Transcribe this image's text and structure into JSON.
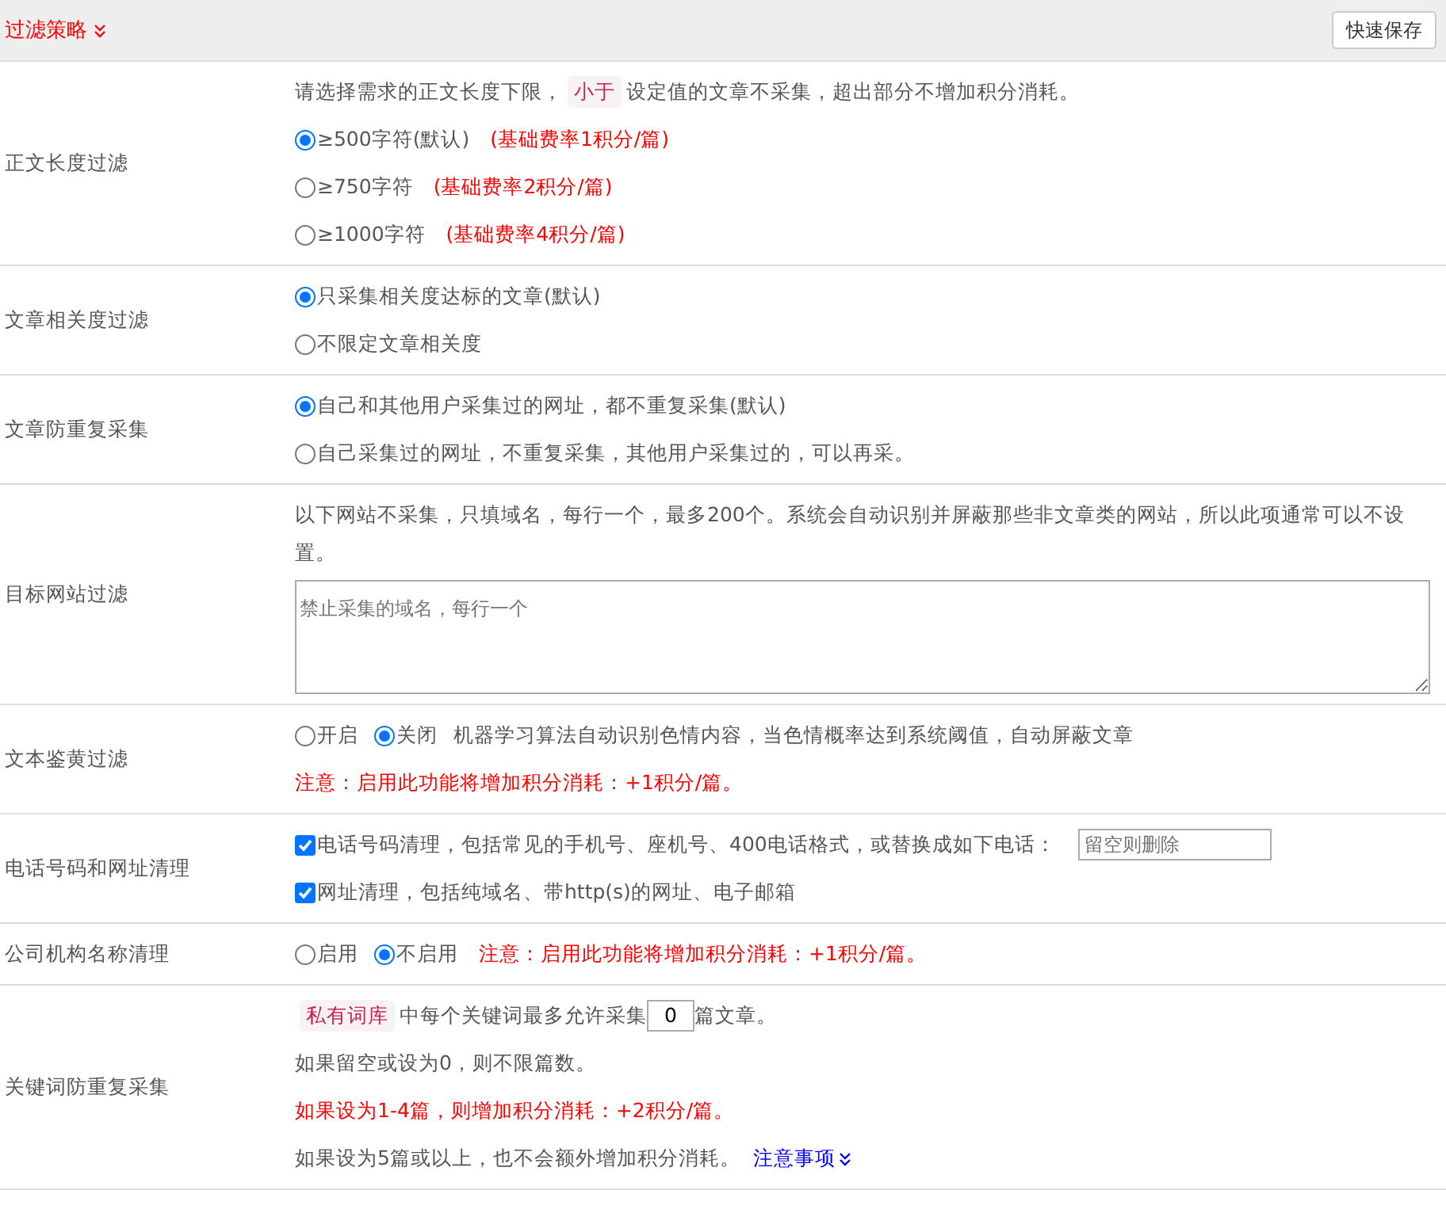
{
  "header": {
    "title": "过滤策略",
    "save_button": "快速保存"
  },
  "rows": [
    {
      "label": "正文长度过滤",
      "lines": [
        [
          {
            "kind": "text",
            "text": "请选择需求的正文长度下限，"
          },
          {
            "kind": "tag",
            "text": "小于"
          },
          {
            "kind": "text",
            "text": "设定值的文章不采集，超出部分不增加积分消耗。"
          }
        ],
        [
          {
            "kind": "radio",
            "text": "≥500字符(默认)",
            "selected": true
          },
          {
            "kind": "note",
            "text": "(基础费率1积分/篇)"
          }
        ],
        [
          {
            "kind": "radio",
            "text": "≥750字符",
            "selected": false
          },
          {
            "kind": "note",
            "text": "(基础费率2积分/篇)"
          }
        ],
        [
          {
            "kind": "radio",
            "text": "≥1000字符",
            "selected": false
          },
          {
            "kind": "note",
            "text": "(基础费率4积分/篇)"
          }
        ]
      ]
    },
    {
      "label": "文章相关度过滤",
      "lines": [
        [
          {
            "kind": "radio",
            "text": "只采集相关度达标的文章(默认)",
            "selected": true
          }
        ],
        [
          {
            "kind": "radio",
            "text": "不限定文章相关度",
            "selected": false
          }
        ]
      ]
    },
    {
      "label": "文章防重复采集",
      "lines": [
        [
          {
            "kind": "radio",
            "text": "自己和其他用户采集过的网址，都不重复采集(默认)",
            "selected": true
          }
        ],
        [
          {
            "kind": "radio",
            "text": "自己采集过的网址，不重复采集，其他用户采集过的，可以再采。",
            "selected": false
          }
        ]
      ]
    },
    {
      "label": "目标网站过滤",
      "lines": [
        [
          {
            "kind": "text",
            "text": "以下网站不采集，只填域名，每行一个，最多200个。系统会自动识别并屏蔽那些非文章类的网站，所以此项通常可以不设置。"
          }
        ],
        [
          {
            "kind": "textarea",
            "placeholder": "禁止采集的域名，每行一个"
          }
        ]
      ]
    },
    {
      "label": "文本鉴黄过滤",
      "lines": [
        [
          {
            "kind": "radio",
            "text": "开启",
            "selected": false
          },
          {
            "kind": "radio",
            "text": "关闭",
            "selected": true
          },
          {
            "kind": "text",
            "text": "机器学习算法自动识别色情内容，当色情概率达到系统阈值，自动屏蔽文章"
          }
        ],
        [
          {
            "kind": "note",
            "text": "注意：启用此功能将增加积分消耗：+1积分/篇。"
          }
        ]
      ]
    },
    {
      "label": "电话号码和网址清理",
      "lines": [
        [
          {
            "kind": "checkbox",
            "text": "电话号码清理，包括常见的手机号、座机号、400电话格式，或替换成如下电话：",
            "checked": true
          },
          {
            "kind": "input",
            "placeholder": "留空则删除"
          }
        ],
        [
          {
            "kind": "checkbox",
            "text": "网址清理，包括纯域名、带http(s)的网址、电子邮箱",
            "checked": true
          }
        ]
      ]
    },
    {
      "label": "公司机构名称清理",
      "lines": [
        [
          {
            "kind": "radio",
            "text": "启用",
            "selected": false
          },
          {
            "kind": "radio",
            "text": "不启用",
            "selected": true
          },
          {
            "kind": "note",
            "text": "注意：启用此功能将增加积分消耗：+1积分/篇。"
          }
        ]
      ]
    },
    {
      "label": "关键词防重复采集",
      "lines": [
        [
          {
            "kind": "tag",
            "text": "私有词库"
          },
          {
            "kind": "text",
            "text": "中每个关键词最多允许采集"
          },
          {
            "kind": "number",
            "value": "0"
          },
          {
            "kind": "text",
            "text": "篇文章。"
          }
        ],
        [
          {
            "kind": "text",
            "text": "如果留空或设为0，则不限篇数。"
          }
        ],
        [
          {
            "kind": "note",
            "text": "如果设为1-4篇，则增加积分消耗：+2积分/篇。"
          }
        ],
        [
          {
            "kind": "text",
            "text": "如果设为5篇或以上，也不会额外增加积分消耗。"
          },
          {
            "kind": "link",
            "text": "注意事项"
          }
        ]
      ]
    }
  ]
}
